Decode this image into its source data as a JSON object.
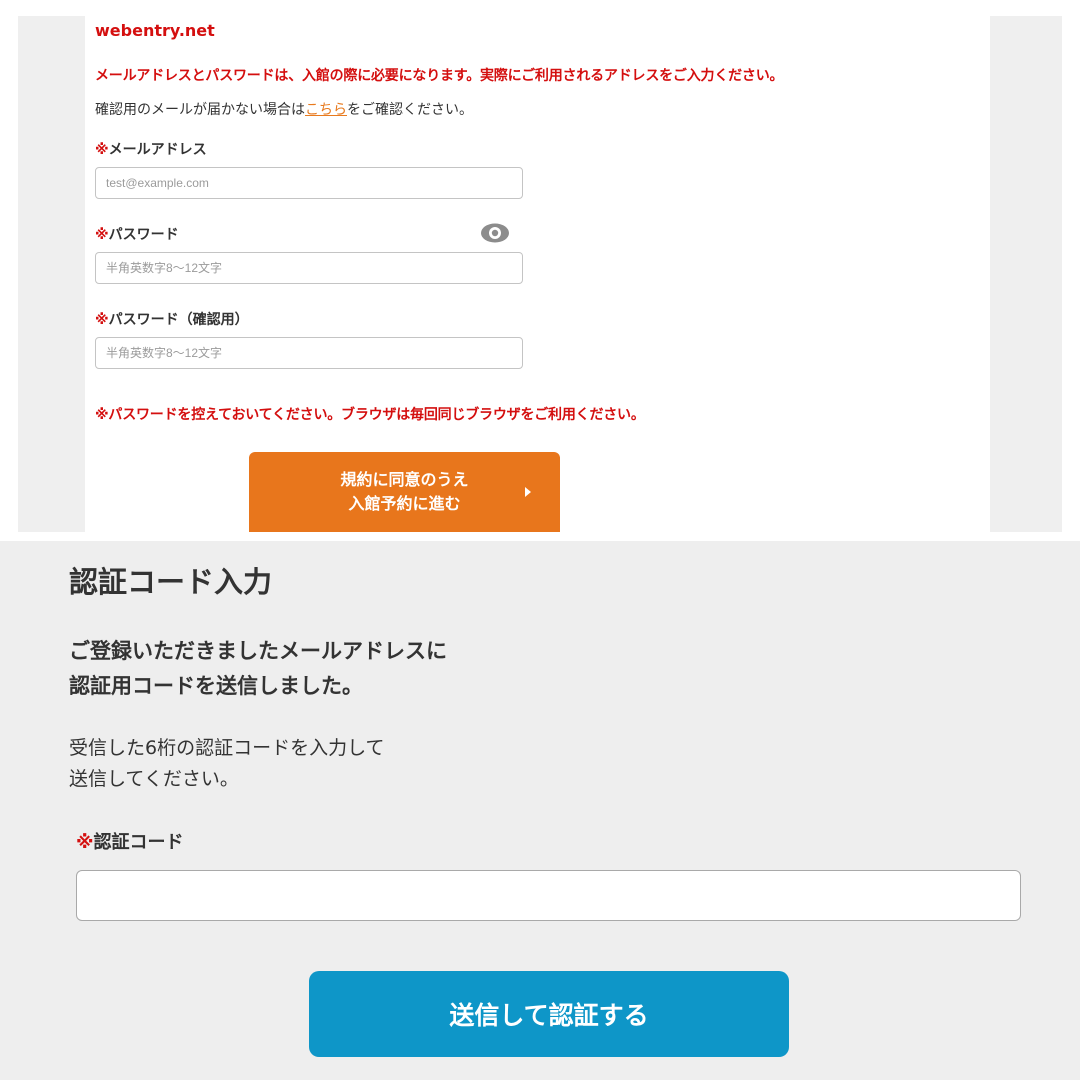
{
  "registration": {
    "site_name": "webentry.net",
    "notice": "メールアドレスとパスワードは、入館の際に必要になります。実際にご利用されるアドレスをご入力ください。",
    "confirm_prefix": "確認用のメールが届かない場合は",
    "confirm_link": "こちら",
    "confirm_suffix": "をご確認ください。",
    "required_mark": "※",
    "email": {
      "label": "メールアドレス",
      "placeholder": "test@example.com",
      "value": ""
    },
    "password": {
      "label": "パスワード",
      "placeholder": "半角英数字8〜12文字",
      "value": "",
      "toggle_icon": "eye-icon"
    },
    "password_confirm": {
      "label": "パスワード（確認用）",
      "placeholder": "半角英数字8〜12文字",
      "value": ""
    },
    "warning": "※パスワードを控えておいてください。ブラウザは毎回同じブラウザをご利用ください。",
    "agree_button": {
      "line1": "規約に同意のうえ",
      "line2": "入館予約に進む",
      "arrow_icon": "caret-right-icon"
    }
  },
  "verification": {
    "title": "認証コード入力",
    "subtitle_line1": "ご登録いただきましたメールアドレスに",
    "subtitle_line2": "認証用コードを送信しました。",
    "desc_line1": "受信した6桁の認証コードを入力して",
    "desc_line2": "送信してください。",
    "required_mark": "※",
    "code_label": "認証コード",
    "code_value": "",
    "submit_label": "送信して認証する"
  },
  "colors": {
    "alert_red": "#d40f0f",
    "link_orange": "#e87a1e",
    "agree_button": "#e8761c",
    "submit_button": "#0e96c8",
    "panel_gray": "#eeeeee"
  }
}
